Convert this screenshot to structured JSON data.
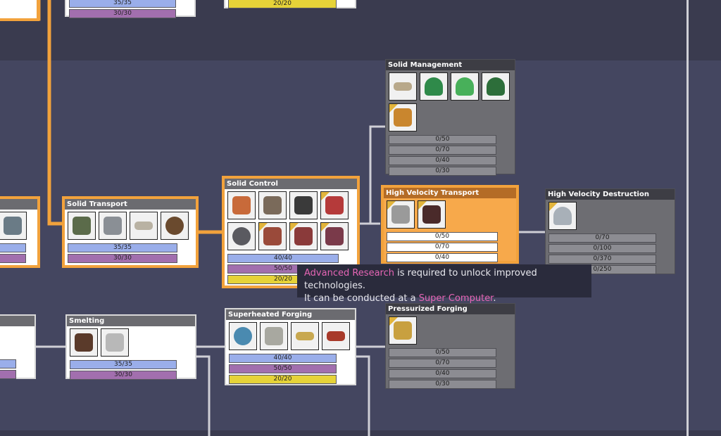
{
  "colors": {
    "available": "#f2a23c",
    "researched": "#ffffff",
    "locked": "#6d6d72",
    "basic": "#9aaeea",
    "advanced": "#a26fae",
    "nuclear": "#e6d338",
    "orbital": "#e8913b"
  },
  "top_partial": {
    "left_bars": [
      "35/35",
      "30/30"
    ],
    "mid_bar": "20/20"
  },
  "nodes": {
    "solid_management": {
      "title": "Solid Management",
      "bars": [
        "0/50",
        "0/70",
        "0/40",
        "0/30"
      ]
    },
    "solid_transport": {
      "title": "Solid Transport",
      "bars": [
        "35/35",
        "30/30"
      ]
    },
    "solid_control": {
      "title": "Solid Control",
      "bars": [
        "40/40",
        "50/50",
        "20/20"
      ]
    },
    "hv_transport": {
      "title": "High Velocity Transport",
      "bars": [
        "0/50",
        "0/70",
        "0/40"
      ]
    },
    "hv_destruction": {
      "title": "High Velocity Destruction",
      "bars": [
        "0/70",
        "0/100",
        "0/370",
        "0/250"
      ]
    },
    "smelting": {
      "title": "Smelting",
      "bars": [
        "35/35",
        "30/30"
      ]
    },
    "superheated_forging": {
      "title": "Superheated Forging",
      "bars": [
        "40/40",
        "50/50",
        "20/20"
      ]
    },
    "pressurized_forging": {
      "title": "Pressurized Forging",
      "bars": [
        "0/50",
        "0/70",
        "0/40",
        "0/30"
      ]
    }
  },
  "tooltip": {
    "line1_highlight": "Advanced Research",
    "line1_rest": " is required to unlock improved technologies.",
    "line2_pre": "It can be conducted at a ",
    "line2_highlight": "Super Computer",
    "line2_post": "."
  }
}
